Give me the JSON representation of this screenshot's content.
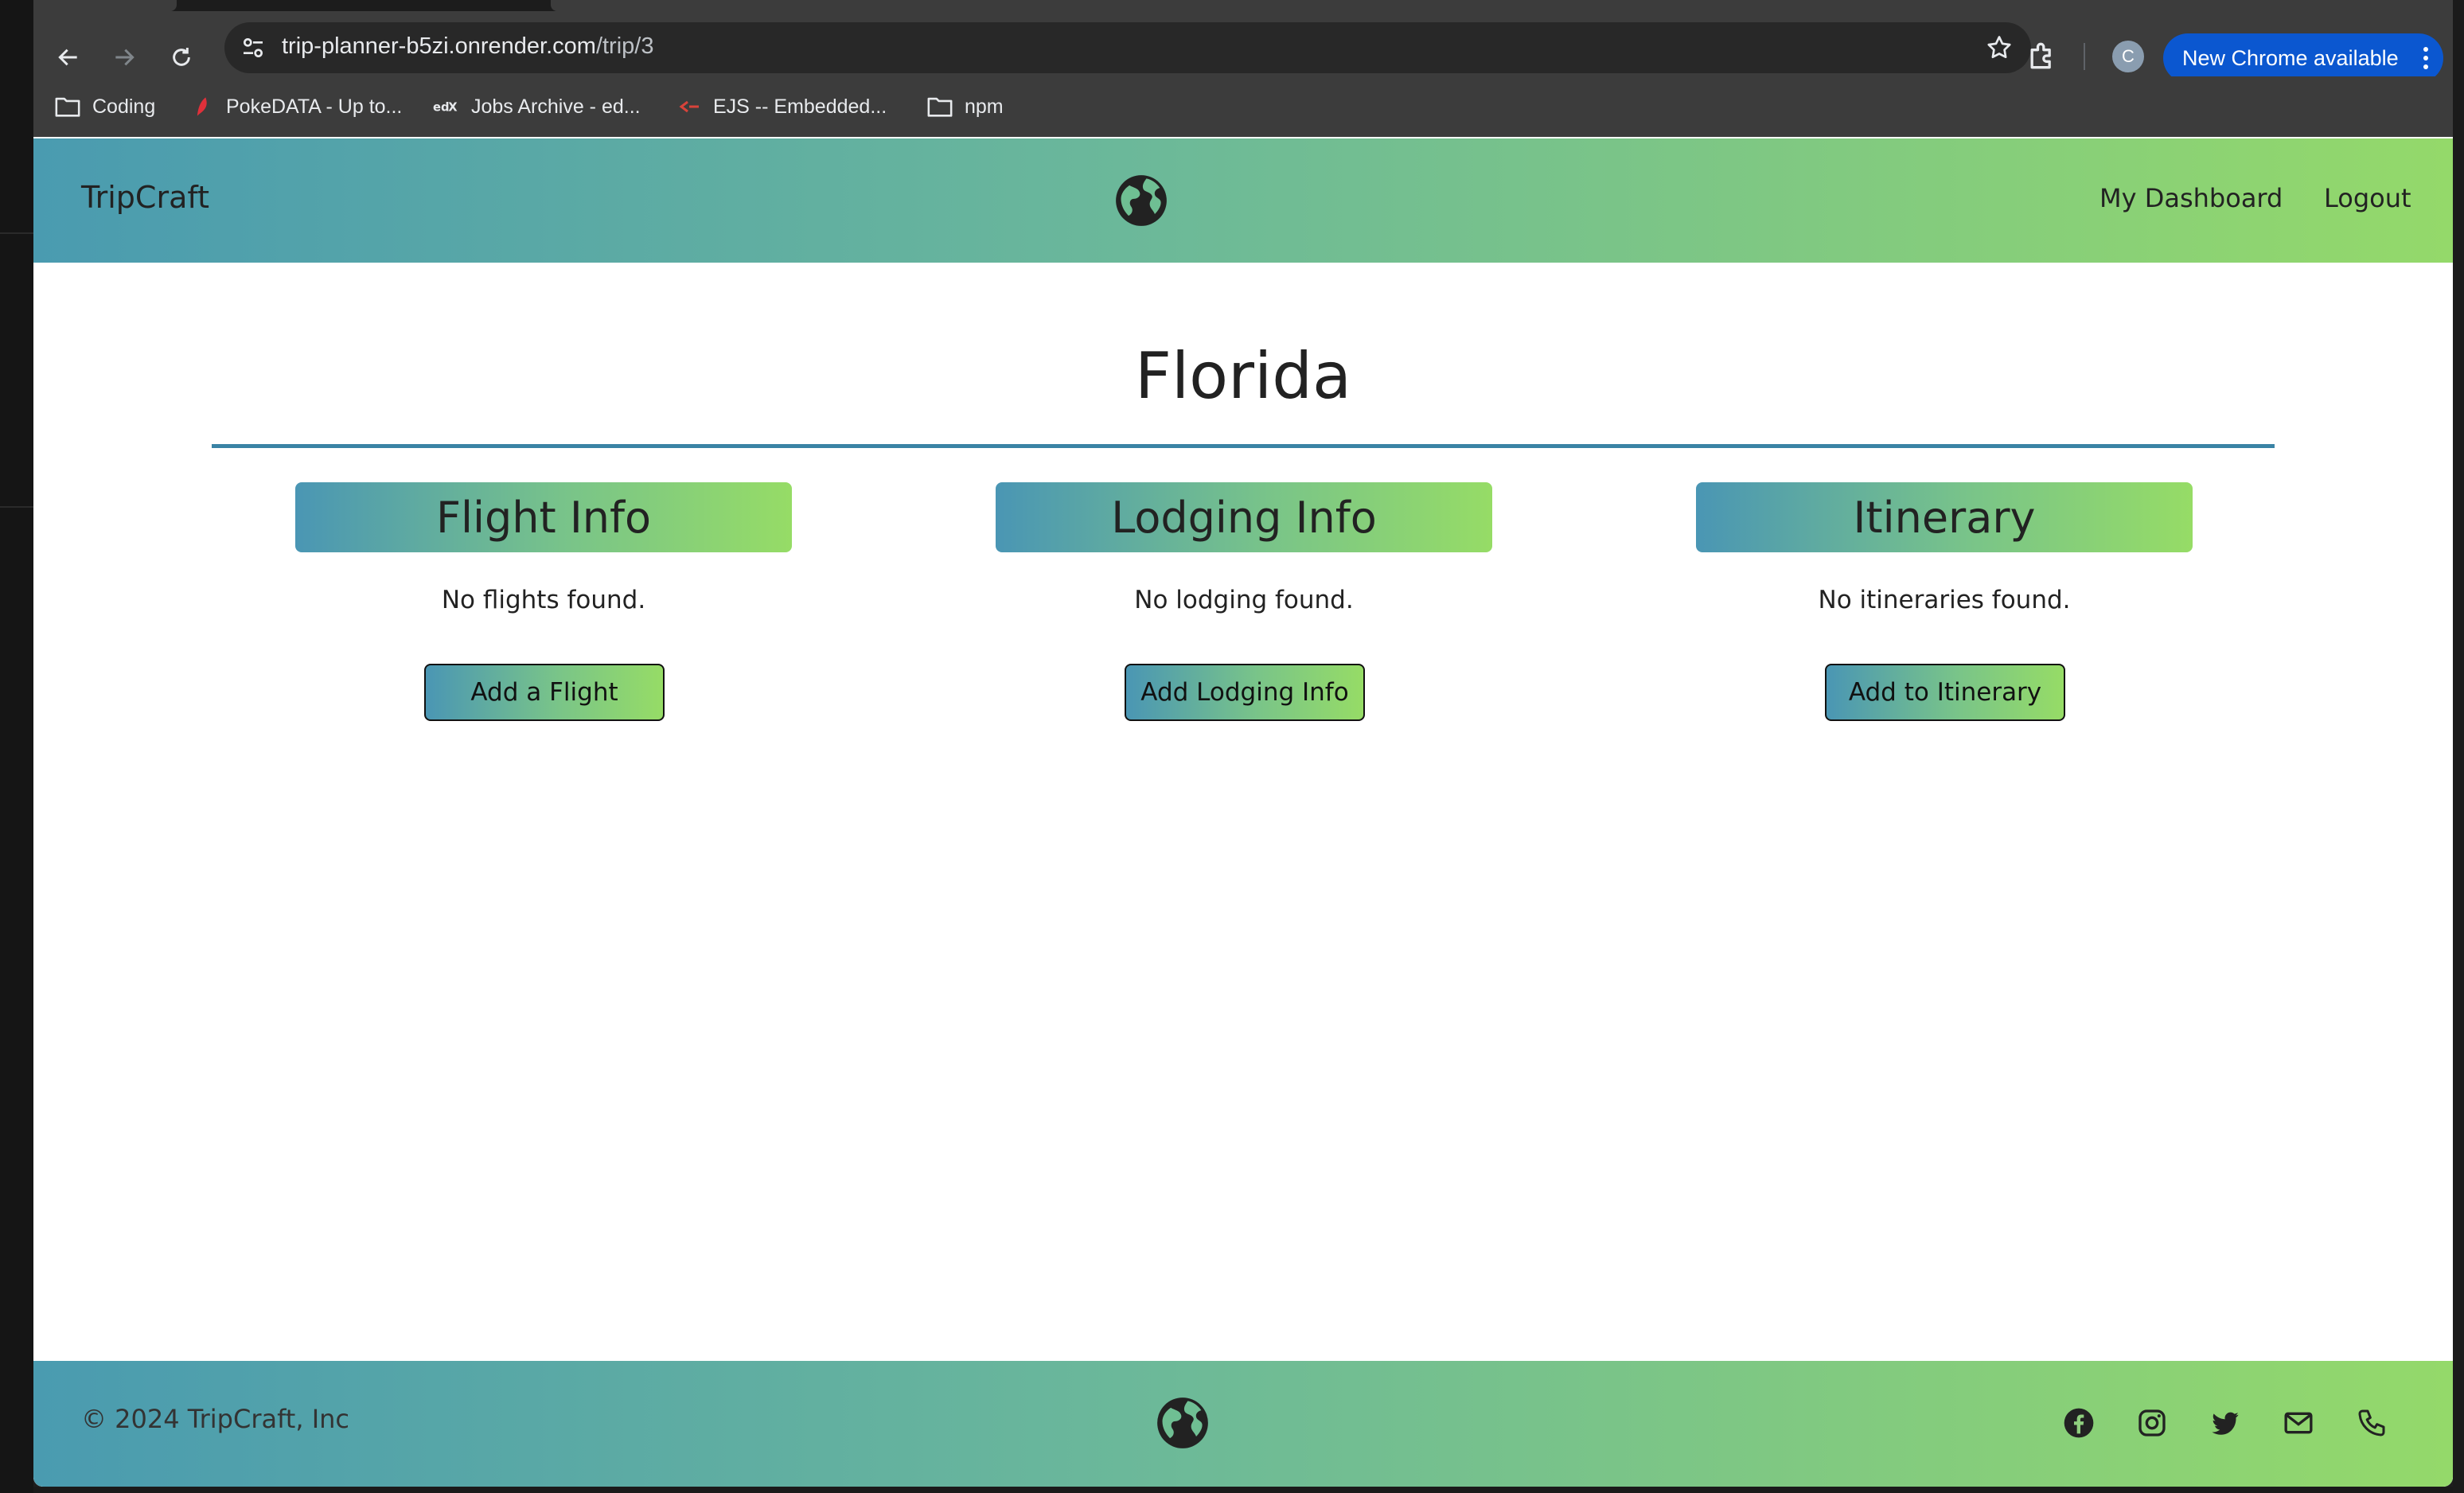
{
  "browser": {
    "url_host": "trip-planner-b5zi.onrender.com",
    "url_path": "/trip/3",
    "profile_initial": "C",
    "update_label": "New Chrome available",
    "bookmarks": [
      {
        "label": "Coding",
        "icon": "folder-icon"
      },
      {
        "label": "PokeDATA - Up to...",
        "icon": "pokedata-favicon"
      },
      {
        "label": "Jobs Archive - ed...",
        "icon": "edx-favicon"
      },
      {
        "label": "EJS -- Embedded...",
        "icon": "ejs-favicon"
      },
      {
        "label": "npm",
        "icon": "folder-icon"
      }
    ]
  },
  "header": {
    "brand": "TripCraft",
    "logo_icon": "globe-icon",
    "nav": [
      {
        "label": "My Dashboard"
      },
      {
        "label": "Logout"
      }
    ]
  },
  "trip": {
    "title": "Florida"
  },
  "sections": [
    {
      "heading": "Flight Info",
      "empty_text": "No flights found.",
      "button_label": "Add a Flight"
    },
    {
      "heading": "Lodging Info",
      "empty_text": "No lodging found.",
      "button_label": "Add Lodging Info"
    },
    {
      "heading": "Itinerary",
      "empty_text": "No itineraries found.",
      "button_label": "Add to Itinerary"
    }
  ],
  "footer": {
    "copyright": "© 2024 TripCraft, Inc",
    "logo_icon": "globe-icon",
    "social": [
      "facebook-icon",
      "instagram-icon",
      "twitter-icon",
      "mail-icon",
      "phone-icon"
    ]
  },
  "colors": {
    "gradient_start": "#4a9bb0",
    "gradient_end": "#94d96a",
    "rule": "#3a83a5",
    "chrome_bar": "#3c3c3c",
    "update_button": "#0b57d0"
  }
}
